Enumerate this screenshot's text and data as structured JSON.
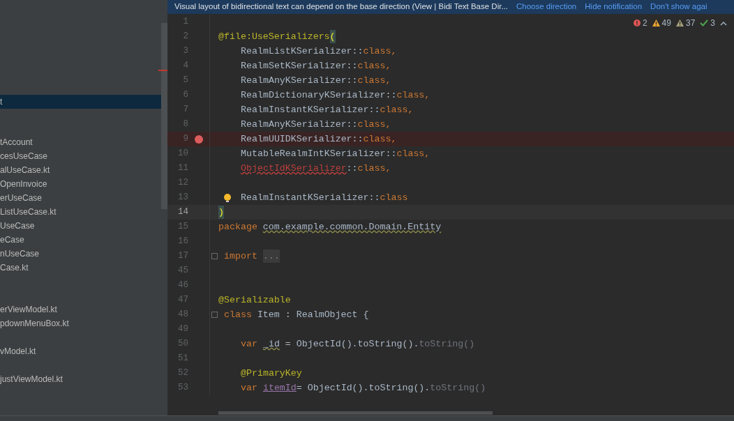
{
  "notification": {
    "message": "Visual layout of bidirectional text can depend on the base direction (View | Bidi Text Base Dir...",
    "actions": [
      "Choose direction",
      "Hide notification",
      "Don't show agai"
    ]
  },
  "sidebar": {
    "sections": [
      [
        {
          "text": "t",
          "selected": true
        }
      ],
      [
        {
          "text": "tAccount",
          "selected": false
        },
        {
          "text": "cesUseCase",
          "selected": false
        },
        {
          "text": "alUseCase.kt",
          "selected": false
        },
        {
          "text": "OpenInvoice",
          "selected": false
        },
        {
          "text": "erUseCase",
          "selected": false
        },
        {
          "text": "ListUseCase.kt",
          "selected": false
        },
        {
          "text": "UseCase",
          "selected": false
        },
        {
          "text": "eCase",
          "selected": false
        },
        {
          "text": "nUseCase",
          "selected": false
        },
        {
          "text": "Case.kt",
          "selected": false
        }
      ],
      [
        {
          "text": "erViewModel.kt",
          "selected": false
        },
        {
          "text": "pdownMenuBox.kt",
          "selected": false
        }
      ],
      [
        {
          "text": "vModel.kt",
          "selected": false
        }
      ],
      [
        {
          "text": "justViewModel.kt",
          "selected": false
        }
      ]
    ]
  },
  "inspections": [
    {
      "kind": "error",
      "count": "2"
    },
    {
      "kind": "warning",
      "count": "49"
    },
    {
      "kind": "weak",
      "count": "37"
    },
    {
      "kind": "typo",
      "count": "3"
    }
  ],
  "lines": [
    {
      "number": "1"
    },
    {
      "number": "2",
      "tokens": [
        {
          "text": "@file:UseSerializers",
          "kind": "annotation"
        },
        {
          "text": "(",
          "kind": "match"
        }
      ]
    },
    {
      "number": "3",
      "indented": true,
      "tokens": [
        {
          "text": "RealmListKSerializer::",
          "kind": "plain"
        },
        {
          "text": "class",
          "kind": "keyword"
        },
        {
          "text": ",",
          "kind": "keyword"
        }
      ]
    },
    {
      "number": "4",
      "indented": true,
      "tokens": [
        {
          "text": "RealmSetKSerializer::",
          "kind": "plain"
        },
        {
          "text": "class",
          "kind": "keyword"
        },
        {
          "text": ",",
          "kind": "keyword"
        }
      ]
    },
    {
      "number": "5",
      "indented": true,
      "tokens": [
        {
          "text": "RealmAnyKSerializer::",
          "kind": "plain"
        },
        {
          "text": "class",
          "kind": "keyword"
        },
        {
          "text": ",",
          "kind": "keyword"
        }
      ]
    },
    {
      "number": "6",
      "indented": true,
      "tokens": [
        {
          "text": "RealmDictionaryKSerializer::",
          "kind": "plain"
        },
        {
          "text": "class",
          "kind": "keyword"
        },
        {
          "text": ",",
          "kind": "keyword"
        }
      ]
    },
    {
      "number": "7",
      "indented": true,
      "tokens": [
        {
          "text": "RealmInstantKSerializer::",
          "kind": "plain"
        },
        {
          "text": "class",
          "kind": "keyword"
        },
        {
          "text": ",",
          "kind": "keyword"
        }
      ]
    },
    {
      "number": "8",
      "indented": true,
      "tokens": [
        {
          "text": "RealmAnyKSerializer::",
          "kind": "plain"
        },
        {
          "text": "class",
          "kind": "keyword"
        },
        {
          "text": ",",
          "kind": "keyword"
        }
      ]
    },
    {
      "number": "9",
      "indented": true,
      "breakpoint": true,
      "tokens": [
        {
          "text": "RealmUUIDKSerializer::",
          "kind": "plain"
        },
        {
          "text": "class",
          "kind": "keyword"
        },
        {
          "text": ",",
          "kind": "keyword"
        }
      ]
    },
    {
      "number": "10",
      "indented": true,
      "tokens": [
        {
          "text": "MutableRealmIntKSerializer::",
          "kind": "plain"
        },
        {
          "text": "class",
          "kind": "keyword"
        },
        {
          "text": ",",
          "kind": "keyword"
        }
      ]
    },
    {
      "number": "11",
      "indented": true,
      "tokens": [
        {
          "text": "ObjectIdKSerializer",
          "kind": "error"
        },
        {
          "text": "::",
          "kind": "plain"
        },
        {
          "text": "class",
          "kind": "keyword"
        },
        {
          "text": ",",
          "kind": "keyword"
        }
      ]
    },
    {
      "number": "12"
    },
    {
      "number": "13",
      "indented": true,
      "bulb": true,
      "tokens": [
        {
          "text": "RealmInstantKSerializer::",
          "kind": "plain"
        },
        {
          "text": "class",
          "kind": "keyword"
        }
      ]
    },
    {
      "number": "14",
      "current": true,
      "tokens": [
        {
          "text": ")",
          "kind": "match"
        }
      ]
    },
    {
      "number": "15",
      "tokens": [
        {
          "text": "package ",
          "kind": "keyword"
        },
        {
          "text": "com.example.common.Domain.Entity",
          "kind": "squiggle"
        }
      ]
    },
    {
      "number": "16"
    },
    {
      "number": "17",
      "fold": true,
      "tokens": [
        {
          "text": "import ",
          "kind": "keyword"
        },
        {
          "text": "...",
          "kind": "folded"
        }
      ]
    },
    {
      "number": "45"
    },
    {
      "number": "46"
    },
    {
      "number": "47",
      "tokens": [
        {
          "text": "@Serializable",
          "kind": "annotation"
        }
      ]
    },
    {
      "number": "48",
      "fold": true,
      "tokens": [
        {
          "text": "class",
          "kind": "keyword"
        },
        {
          "text": " Item : RealmObject {",
          "kind": "plain"
        }
      ]
    },
    {
      "number": "49"
    },
    {
      "number": "50",
      "indented": true,
      "tokens": [
        {
          "text": "var ",
          "kind": "keyword"
        },
        {
          "text": "_id",
          "kind": "squiggle"
        },
        {
          "text": " = ObjectId().toString().",
          "kind": "plain"
        },
        {
          "text": "toString()",
          "kind": "dim"
        }
      ]
    },
    {
      "number": "51"
    },
    {
      "number": "52",
      "indented": true,
      "tokens": [
        {
          "text": "@PrimaryKey",
          "kind": "annotation"
        }
      ]
    },
    {
      "number": "53",
      "indented": true,
      "tokens": [
        {
          "text": "var ",
          "kind": "keyword"
        },
        {
          "text": "itemId",
          "kind": "property"
        },
        {
          "text": "= ObjectId().toString().",
          "kind": "plain"
        },
        {
          "text": "toString()",
          "kind": "dim"
        }
      ]
    }
  ]
}
